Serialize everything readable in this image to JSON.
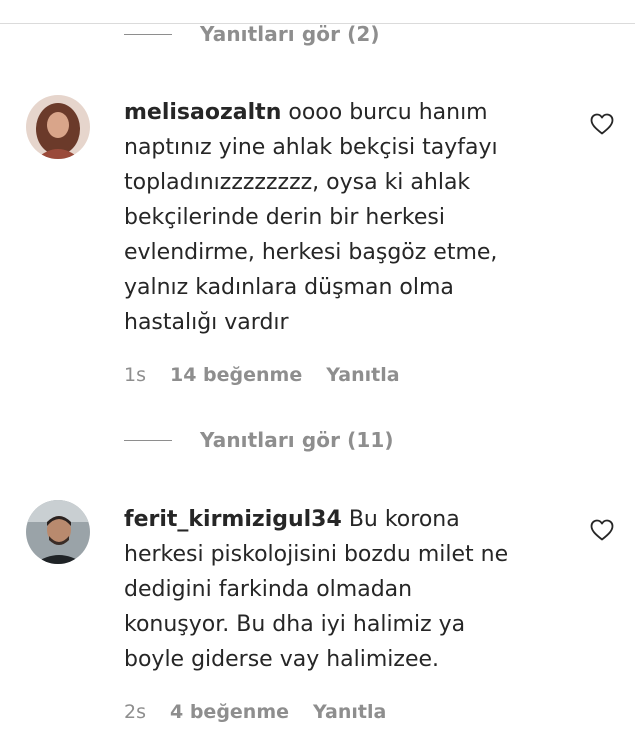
{
  "thread_top": {
    "replies_label": "Yanıtları gör (2)"
  },
  "comments": [
    {
      "username": "melisaozaltn",
      "text": "oooo burcu hanım\nnaptınız yine ahlak bekçisi tayfayı\ntopladınızzzzzzzz, oysa ki ahlak\nbekçilerinde derin bir herkesi\nevlendirme, herkesi başgöz etme,\nyalnız kadınlara düşman olma\nhastalığı vardır",
      "time": "1s",
      "likes": "14 beğenme",
      "reply_label": "Yanıtla",
      "replies_label": "Yanıtları gör (11)",
      "like_icon": "heart-outline-icon"
    },
    {
      "username": "ferit_kirmizigul34",
      "text": "Bu korona\nherkesi piskolojisini bozdu milet ne\ndedigini farkinda olmadan\nkonuşyor. Bu dha iyi halimiz ya\nboyle giderse vay halimizee.",
      "time": "2s",
      "likes": "4 beğenme",
      "reply_label": "Yanıtla",
      "like_icon": "heart-outline-icon"
    }
  ],
  "colors": {
    "text": "#262626",
    "muted": "#8e8e8e",
    "border": "#dbdbdb"
  }
}
